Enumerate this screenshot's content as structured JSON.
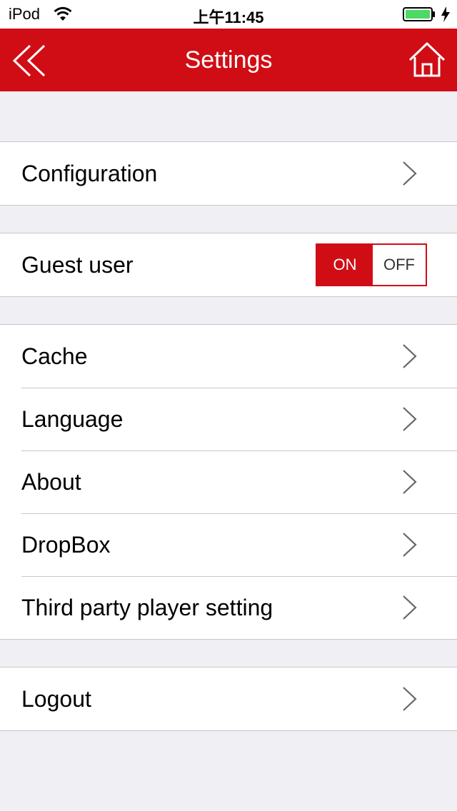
{
  "status_bar": {
    "carrier": "iPod",
    "time": "上午11:45"
  },
  "nav": {
    "title": "Settings",
    "back_icon": "double-chevron-left-icon",
    "home_icon": "home-icon"
  },
  "colors": {
    "accent": "#d00d15",
    "battery": "#4cd964"
  },
  "groups": [
    {
      "items": [
        {
          "label": "Configuration",
          "type": "disclosure"
        }
      ]
    },
    {
      "items": [
        {
          "label": "Guest user",
          "type": "toggle",
          "on_label": "ON",
          "off_label": "OFF",
          "value": "ON"
        }
      ]
    },
    {
      "items": [
        {
          "label": "Cache",
          "type": "disclosure"
        },
        {
          "label": "Language",
          "type": "disclosure"
        },
        {
          "label": "About",
          "type": "disclosure"
        },
        {
          "label": "DropBox",
          "type": "disclosure"
        },
        {
          "label": "Third party player setting",
          "type": "disclosure"
        }
      ]
    },
    {
      "items": [
        {
          "label": "Logout",
          "type": "disclosure"
        }
      ]
    }
  ]
}
